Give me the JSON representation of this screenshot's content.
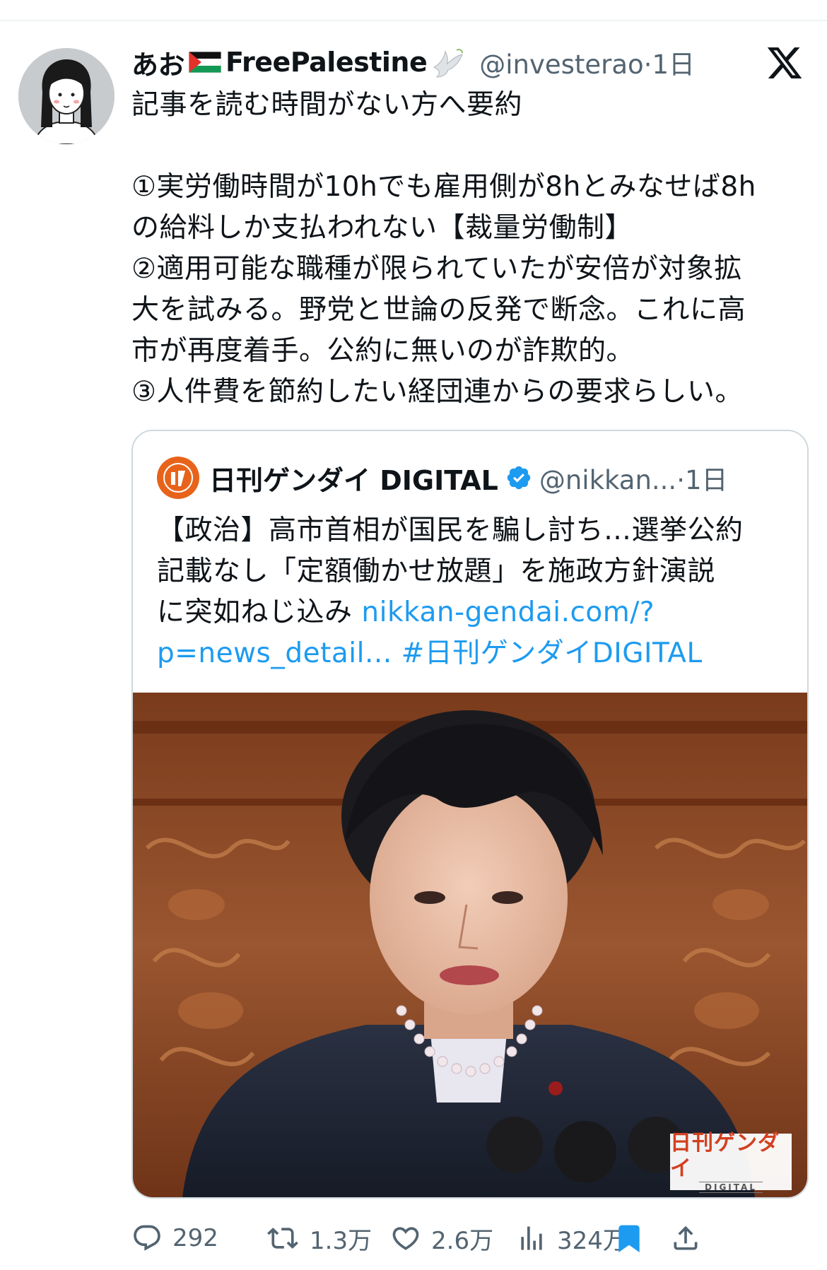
{
  "post": {
    "display_name": "あお",
    "display_name_suffix": "FreePalestine",
    "handle": "@investerao",
    "time": "·1日",
    "lines": [
      "記事を読む時間がない方へ要約",
      "",
      "①実労働時間が10hでも雇用側が8hとみなせば8h",
      "の給料しか支払われない【裁量労働制】",
      "②適用可能な職種が限られていたが安倍が対象拡",
      "大を試みる。野党と世論の反発で断念。これに高",
      "市が再度着手。公約に無いのが詐欺的。",
      "③人件費を節約したい経団連からの要求らしい。"
    ]
  },
  "quote": {
    "name": "日刊ゲンダイ DIGITAL",
    "handle": "@nikkan...",
    "time": "·1日",
    "lines": [
      "【政治】高市首相が国民を騙し討ち…選挙公約",
      "記載なし「定額働かせ放題」を施政方針演説"
    ],
    "line3_text": "に突如ねじ込み ",
    "line3_link": "nikkan-gendai.com/?",
    "line4_link": "p=news_detail...",
    "line4_hashtag": " #日刊ゲンダイDIGITAL",
    "image_watermark": "日刊ゲンダイ",
    "image_watermark_sub": "DIGITAL"
  },
  "actions": {
    "replies": "292",
    "reposts": "1.3万",
    "likes": "2.6万",
    "views": "324万"
  },
  "colors": {
    "text": "#0f1419",
    "muted": "#536471",
    "link": "#1d9bf0",
    "border": "#cfd9de",
    "bookmark": "#1d9bf0"
  }
}
